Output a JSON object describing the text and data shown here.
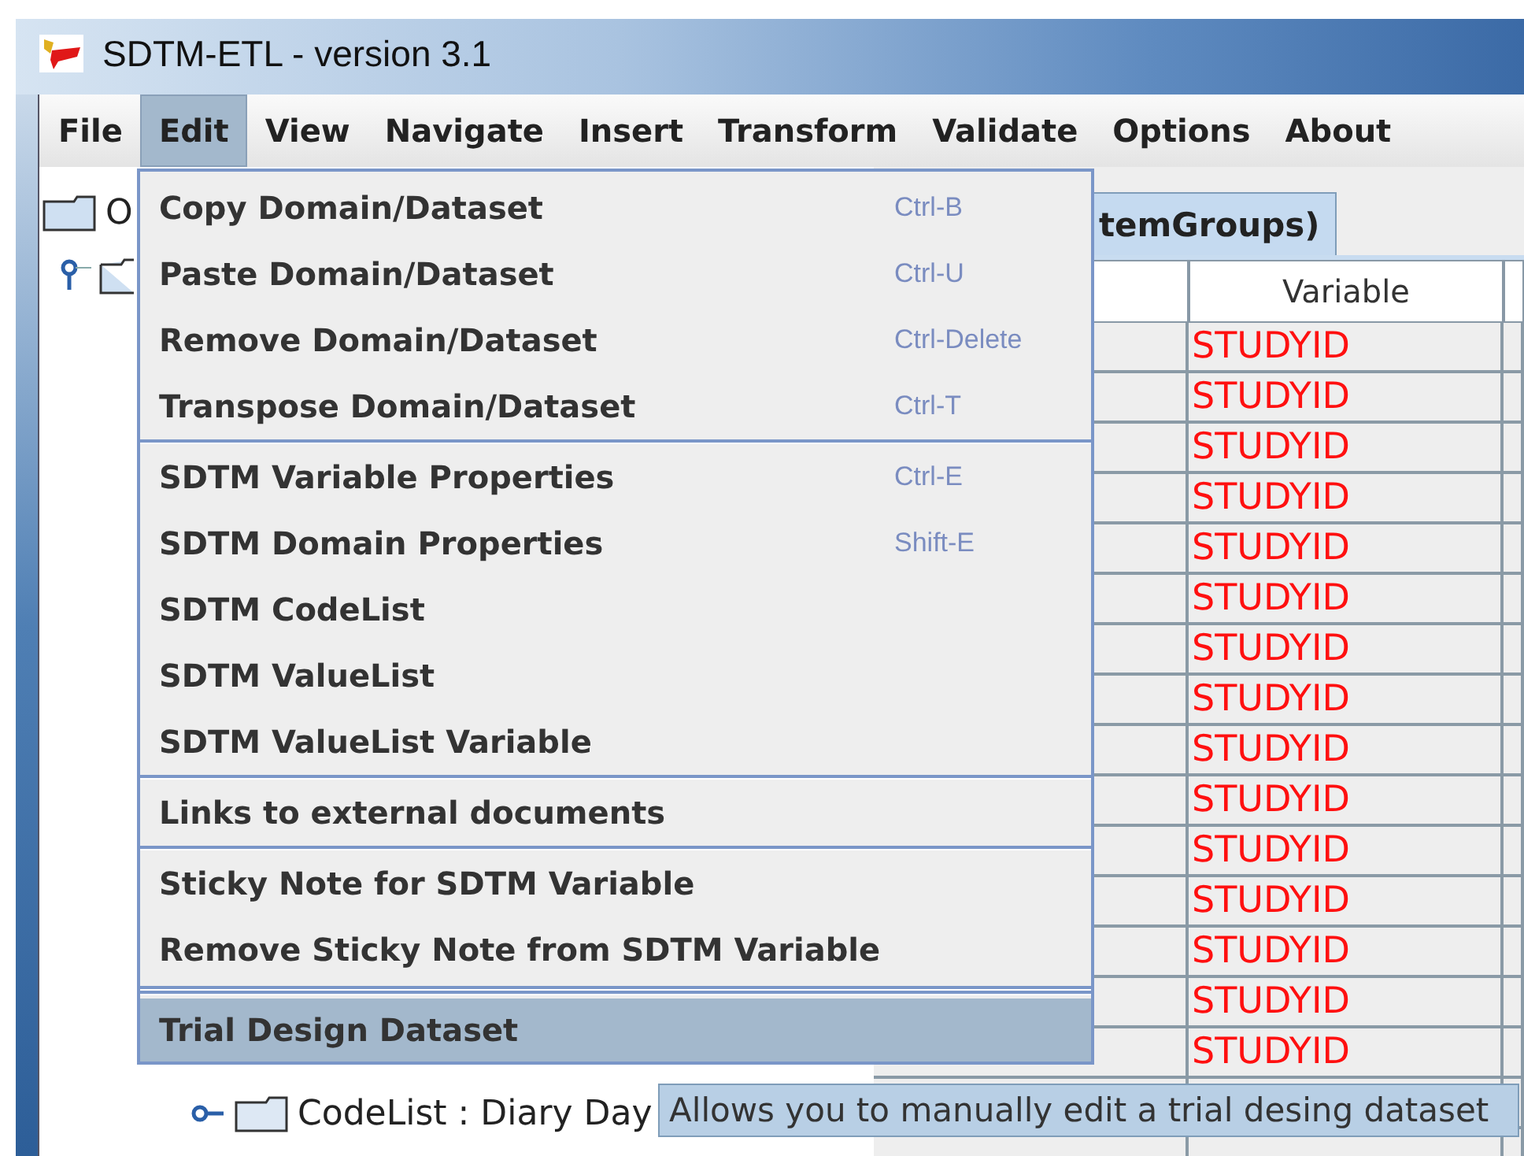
{
  "window": {
    "title": "SDTM-ETL - version 3.1"
  },
  "menubar": [
    {
      "label": "File",
      "selected": false
    },
    {
      "label": "Edit",
      "selected": true
    },
    {
      "label": "View",
      "selected": false
    },
    {
      "label": "Navigate",
      "selected": false
    },
    {
      "label": "Insert",
      "selected": false
    },
    {
      "label": "Transform",
      "selected": false
    },
    {
      "label": "Validate",
      "selected": false
    },
    {
      "label": "Options",
      "selected": false
    },
    {
      "label": "About",
      "selected": false
    }
  ],
  "tree": {
    "root_label": "O",
    "child": {
      "expanded": true
    },
    "node": {
      "label": "CodeList : Diary Day",
      "expanded": false
    }
  },
  "tab": {
    "label": "temGroups)",
    "selected": true
  },
  "table": {
    "columns": [
      "Variable"
    ],
    "rows": [
      {
        "variable": "STUDYID"
      },
      {
        "variable": "STUDYID"
      },
      {
        "variable": "STUDYID"
      },
      {
        "variable": "STUDYID"
      },
      {
        "variable": "STUDYID"
      },
      {
        "variable": "STUDYID"
      },
      {
        "variable": "STUDYID"
      },
      {
        "variable": "STUDYID"
      },
      {
        "variable": "STUDYID"
      },
      {
        "variable": "STUDYID"
      },
      {
        "variable": "STUDYID"
      },
      {
        "variable": "STUDYID"
      },
      {
        "variable": "STUDYID"
      },
      {
        "variable": "STUDYID"
      },
      {
        "variable": "STUDYID"
      }
    ]
  },
  "edit_menu": [
    {
      "kind": "item",
      "label": "Copy Domain/Dataset",
      "shortcut": "Ctrl-B",
      "selected": false
    },
    {
      "kind": "item",
      "label": "Paste Domain/Dataset",
      "shortcut": "Ctrl-U",
      "selected": false
    },
    {
      "kind": "item",
      "label": "Remove Domain/Dataset",
      "shortcut": "Ctrl-Delete",
      "selected": false
    },
    {
      "kind": "item",
      "label": "Transpose Domain/Dataset",
      "shortcut": "Ctrl-T",
      "selected": false
    },
    {
      "kind": "separator"
    },
    {
      "kind": "item",
      "label": "SDTM Variable Properties",
      "shortcut": "Ctrl-E",
      "selected": false
    },
    {
      "kind": "item",
      "label": "SDTM Domain Properties",
      "shortcut": "Shift-E",
      "selected": false
    },
    {
      "kind": "item",
      "label": "SDTM CodeList",
      "selected": false
    },
    {
      "kind": "item",
      "label": "SDTM ValueList",
      "selected": false
    },
    {
      "kind": "item",
      "label": "SDTM ValueList Variable",
      "selected": false
    },
    {
      "kind": "separator"
    },
    {
      "kind": "item",
      "label": "Links to external documents",
      "selected": false
    },
    {
      "kind": "separator"
    },
    {
      "kind": "item",
      "label": "Sticky Note for SDTM Variable",
      "selected": false
    },
    {
      "kind": "item",
      "label": "Remove Sticky Note from SDTM Variable",
      "selected": false
    },
    {
      "kind": "double-separator"
    },
    {
      "kind": "item",
      "label": "Trial Design Dataset",
      "selected": true
    }
  ],
  "tooltip": {
    "text": "Allows you to manually edit a trial desing dataset"
  }
}
